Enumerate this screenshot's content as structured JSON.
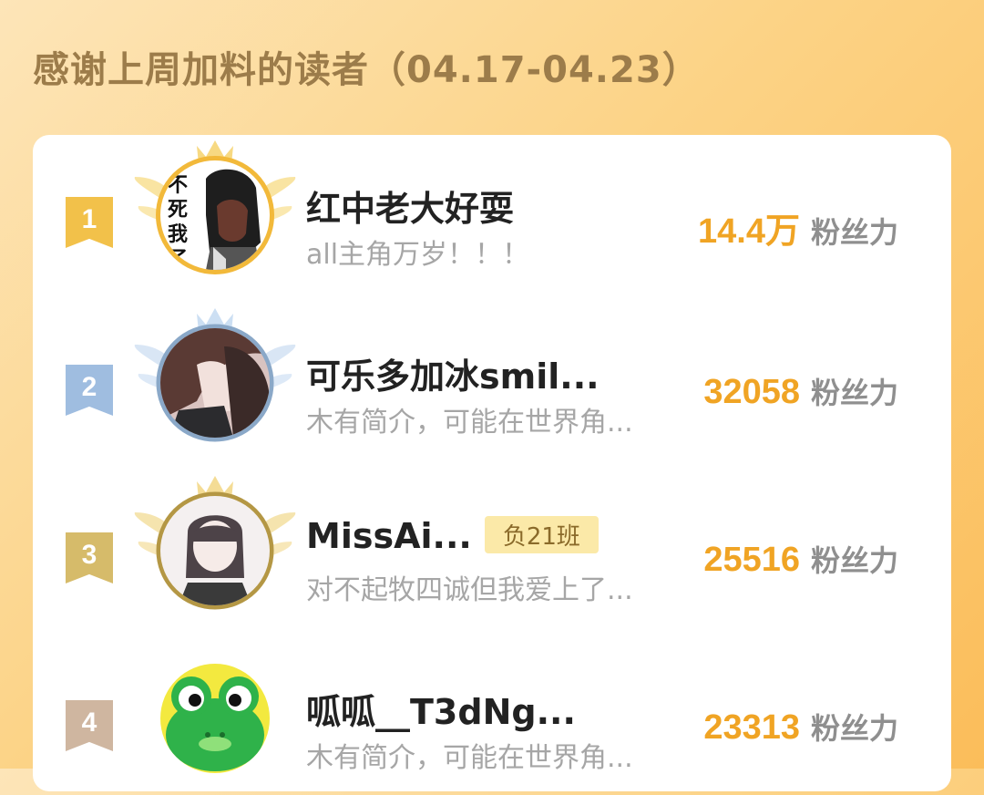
{
  "header": {
    "title": "感谢上周加料的读者（04.17-04.23）"
  },
  "readers": [
    {
      "rank": "1",
      "name": "红中老大好耍",
      "tag": "",
      "intro": "all主角万岁！！！",
      "fans_value": "14.4万",
      "fans_unit": "粉丝力",
      "avatar_text": [
        "不",
        "死",
        "我",
        "了"
      ]
    },
    {
      "rank": "2",
      "name": "可乐多加冰smil...",
      "tag": "",
      "intro": "木有简介，可能在世界角...",
      "fans_value": "32058",
      "fans_unit": "粉丝力"
    },
    {
      "rank": "3",
      "name": "MissAi...",
      "tag": "负21班",
      "intro": "对不起牧四诚但我爱上了...",
      "fans_value": "25516",
      "fans_unit": "粉丝力"
    },
    {
      "rank": "4",
      "name": "呱呱__T3dNg...",
      "tag": "",
      "intro": "木有简介，可能在世界角...",
      "fans_value": "23313",
      "fans_unit": "粉丝力"
    }
  ],
  "colors": {
    "rank1": "#f2c14a",
    "rank2": "#9fbde0",
    "rank3": "#d6bb6a",
    "rank4": "#cfb6a0",
    "fans_value": "#f0a424",
    "fans_unit": "#8f8f8f",
    "accent_bg": "#fcd386"
  }
}
